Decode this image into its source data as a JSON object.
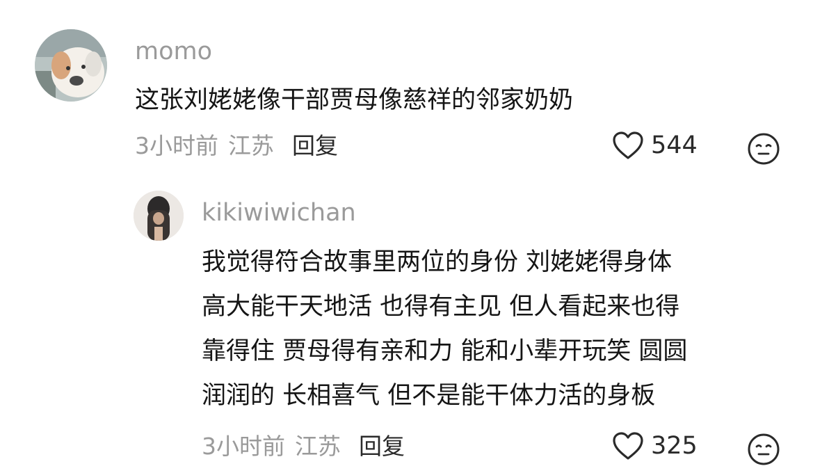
{
  "comments": [
    {
      "username": "momo",
      "text": "这张刘姥姥像干部贾母像慈祥的邻家奶奶",
      "time": "3小时前",
      "location": "江苏",
      "reply_label": "回复",
      "likes": "544"
    }
  ],
  "replies": [
    {
      "username": "kikiwiwichan",
      "text": "我觉得符合故事里两位的身份 刘姥姥得身体\n高大能干天地活 也得有主见 但人看起来也得\n靠得住 贾母得有亲和力 能和小辈开玩笑 圆圆\n润润的 长相喜气 但不是能干体力活的身板",
      "time": "3小时前",
      "location": "江苏",
      "reply_label": "回复",
      "likes": "325"
    }
  ],
  "icons": {
    "like": "heart-outline-icon",
    "react": "neutral-face-icon"
  },
  "colors": {
    "meta_gray": "#9a9a9a",
    "text_dark": "#151515"
  }
}
